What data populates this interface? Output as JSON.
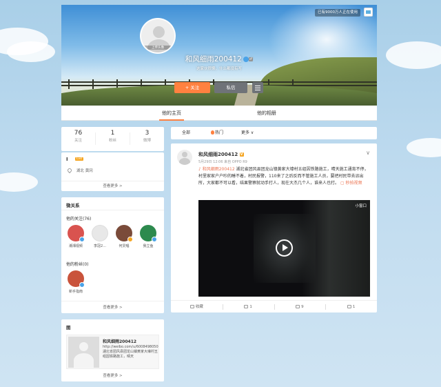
{
  "header": {
    "top_badge": "已有9000万人正在使用",
    "avatar_caption": "上传头像",
    "profile_name": "和风细雨200412",
    "subtitle": "这家伙很懒，什么都没有写",
    "follow_label": "+ 关注",
    "message_label": "私信"
  },
  "tabs": [
    {
      "label": "他的主页"
    },
    {
      "label": "他的相册"
    }
  ],
  "stats": [
    {
      "num": "76",
      "label": "关注"
    },
    {
      "num": "1",
      "label": "粉丝"
    },
    {
      "num": "3",
      "label": "微博"
    }
  ],
  "info": {
    "title": "I",
    "badge": "Lv4",
    "location": "湖北 黄冈",
    "more": "查看更多 >"
  },
  "relations": {
    "title": "微关系",
    "following_label": "他的关注(76)",
    "following": [
      {
        "name": "潮湘视频",
        "color": "#d9534f"
      },
      {
        "name": "李冠2...",
        "color": "#e8e8e8"
      },
      {
        "name": "何炅唱",
        "color": "#7a4b3a"
      },
      {
        "name": "我立鱼",
        "color": "#2d8a4e"
      }
    ],
    "fans_label": "他的粉丝(0)",
    "fans": [
      {
        "name": "新手指南",
        "color": "#c9533b"
      }
    ],
    "more": "查看更多 >"
  },
  "photos": {
    "title": "图",
    "post_title": "和风细雨200412",
    "post_text": "http://weibo.com/u/6008498050 湖北省团风县团龙山镇黄家大壕村五组因铁路施工，晴天",
    "more": "查看更多 >"
  },
  "feed_tabs": [
    {
      "label": "全部"
    },
    {
      "label": "热门"
    },
    {
      "label": "更多 ∨"
    }
  ],
  "post": {
    "author": "和风细雨200412",
    "meta": "5月29日 12:06 来自 OPPO R9",
    "chevron": "∨",
    "tag": "♪ 和风细雨200412",
    "text": " 湖北省团风县团龙山镇黄家大壕村五组因铁路施工，晴天施工通宵不停，村里家家户户吵的睡不着，村民报警，110来了之后反而不管施工人员，要把村民带去派出所，大家都不可以看，结果警察就动手打人，现在大杰几个人，谁来人也打。",
    "link": "秒拍视频",
    "mini_label": "小窗口",
    "actions": [
      {
        "label": "收藏"
      },
      {
        "label": "1"
      },
      {
        "label": "9"
      },
      {
        "label": "1"
      }
    ]
  }
}
